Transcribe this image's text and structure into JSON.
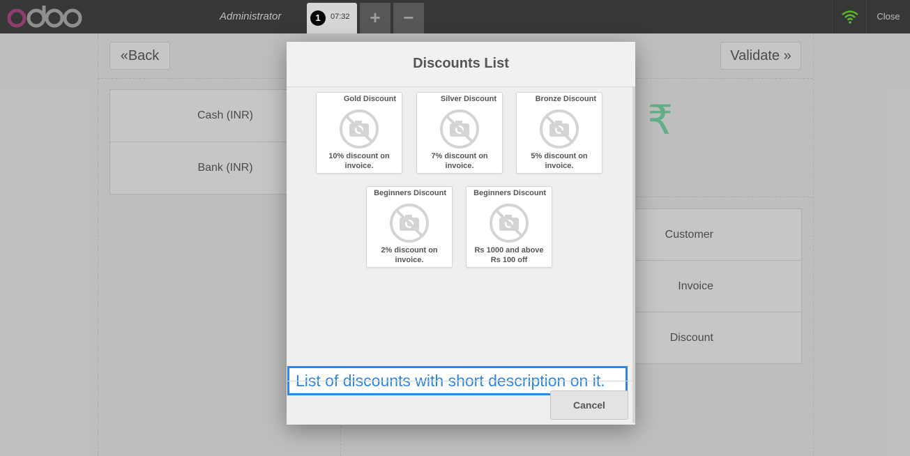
{
  "header": {
    "user_name": "Administrator",
    "order_number": "1",
    "order_time": "07:32",
    "add_order": "+",
    "remove_order": "−",
    "close_label": "Close"
  },
  "payment_screen": {
    "back_label": "Back",
    "validate_label": "Validate",
    "payment_methods": [
      "Cash (INR)",
      "Bank (INR)"
    ],
    "amount_fragment": "0 ₹",
    "actions": [
      "Customer",
      "Invoice",
      "Discount"
    ]
  },
  "modal": {
    "title": "Discounts List",
    "cards": [
      {
        "name": "Gold Discount",
        "description": "10% discount on invoice."
      },
      {
        "name": "Silver Discount",
        "description": "7% discount on invoice."
      },
      {
        "name": "Bronze Discount",
        "description": "5% discount on invoice."
      },
      {
        "name": "Beginners Discount",
        "description": "2% discount on invoice."
      },
      {
        "name": "Beginners Discount",
        "description": "Rs 1000 and above Rs 100 off"
      }
    ],
    "annotation": "List of discounts with short description on it.",
    "cancel_label": "Cancel"
  },
  "colors": {
    "header_bg": "#373737",
    "accent_green": "#6ec89b",
    "wifi_green": "#5cb82e",
    "annotation_blue": "#2e86de"
  }
}
